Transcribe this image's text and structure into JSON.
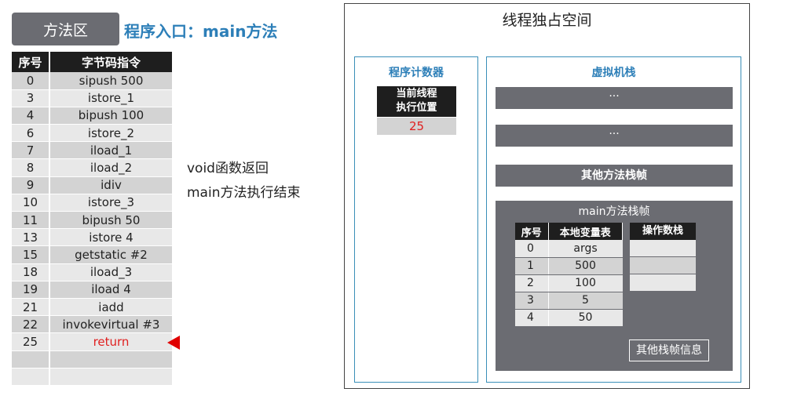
{
  "method_area": {
    "tag": "方法区",
    "entry_title": "程序入口：main方法",
    "table": {
      "headers": [
        "序号",
        "字节码指令"
      ],
      "rows": [
        {
          "idx": "0",
          "instr": "sipush 500"
        },
        {
          "idx": "3",
          "instr": "istore_1"
        },
        {
          "idx": "4",
          "instr": "bipush 100"
        },
        {
          "idx": "6",
          "instr": "istore_2"
        },
        {
          "idx": "7",
          "instr": "iload_1"
        },
        {
          "idx": "8",
          "instr": "iload_2"
        },
        {
          "idx": "9",
          "instr": "idiv"
        },
        {
          "idx": "10",
          "instr": "istore_3"
        },
        {
          "idx": "11",
          "instr": "bipush 50"
        },
        {
          "idx": "13",
          "instr": "istore 4"
        },
        {
          "idx": "15",
          "instr": "getstatic #2"
        },
        {
          "idx": "18",
          "instr": "iload_3"
        },
        {
          "idx": "19",
          "instr": "iload 4"
        },
        {
          "idx": "21",
          "instr": "iadd"
        },
        {
          "idx": "22",
          "instr": "invokevirtual #3"
        },
        {
          "idx": "25",
          "instr": "return"
        },
        {
          "idx": "",
          "instr": ""
        },
        {
          "idx": "",
          "instr": ""
        }
      ]
    },
    "current_instruction_index": 15,
    "notes": [
      "void函数返回",
      "main方法执行结束"
    ]
  },
  "thread": {
    "title": "线程独占空间",
    "pc": {
      "title": "程序计数器",
      "head_line1": "当前线程",
      "head_line2": "执行位置",
      "value": "25"
    },
    "vm_stack": {
      "title": "虚拟机栈",
      "frames": [
        "···",
        "···",
        "其他方法栈帧"
      ],
      "main_frame": {
        "title": "main方法栈帧",
        "local_vars": {
          "headers": [
            "序号",
            "本地变量表"
          ],
          "rows": [
            {
              "i": "0",
              "v": "args"
            },
            {
              "i": "1",
              "v": "500"
            },
            {
              "i": "2",
              "v": "100"
            },
            {
              "i": "3",
              "v": "5"
            },
            {
              "i": "4",
              "v": "50"
            }
          ]
        },
        "operand_stack": {
          "header": "操作数栈",
          "slots": [
            "",
            "",
            ""
          ]
        },
        "other_info": "其他栈帧信息"
      }
    }
  },
  "colors": {
    "accent_blue": "#2d7fb8",
    "dark_gray": "#6b6c72",
    "header_black": "#1e1e1e",
    "highlight_red": "#e02020"
  }
}
